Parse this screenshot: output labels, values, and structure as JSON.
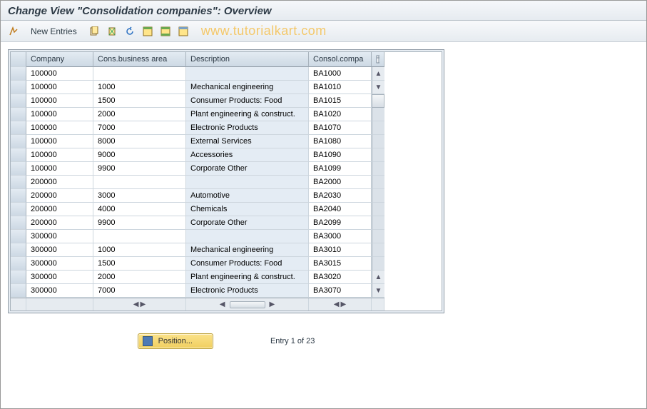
{
  "title": "Change View \"Consolidation companies\": Overview",
  "watermark": "www.tutorialkart.com",
  "toolbar": {
    "new_entries": "New Entries"
  },
  "columns": {
    "company": "Company",
    "cons_ba": "Cons.business area",
    "description": "Description",
    "consol": "Consol.compa"
  },
  "rows": [
    {
      "company": "100000",
      "cba": "",
      "desc": "",
      "cc": "BA1000"
    },
    {
      "company": "100000",
      "cba": "1000",
      "desc": "Mechanical engineering",
      "cc": "BA1010"
    },
    {
      "company": "100000",
      "cba": "1500",
      "desc": "Consumer Products: Food",
      "cc": "BA1015"
    },
    {
      "company": "100000",
      "cba": "2000",
      "desc": "Plant engineering & construct.",
      "cc": "BA1020"
    },
    {
      "company": "100000",
      "cba": "7000",
      "desc": "Electronic Products",
      "cc": "BA1070"
    },
    {
      "company": "100000",
      "cba": "8000",
      "desc": "External Services",
      "cc": "BA1080"
    },
    {
      "company": "100000",
      "cba": "9000",
      "desc": "Accessories",
      "cc": "BA1090"
    },
    {
      "company": "100000",
      "cba": "9900",
      "desc": "Corporate Other",
      "cc": "BA1099"
    },
    {
      "company": "200000",
      "cba": "",
      "desc": "",
      "cc": "BA2000"
    },
    {
      "company": "200000",
      "cba": "3000",
      "desc": "Automotive",
      "cc": "BA2030"
    },
    {
      "company": "200000",
      "cba": "4000",
      "desc": "Chemicals",
      "cc": "BA2040"
    },
    {
      "company": "200000",
      "cba": "9900",
      "desc": "Corporate Other",
      "cc": "BA2099"
    },
    {
      "company": "300000",
      "cba": "",
      "desc": "",
      "cc": "BA3000"
    },
    {
      "company": "300000",
      "cba": "1000",
      "desc": "Mechanical engineering",
      "cc": "BA3010"
    },
    {
      "company": "300000",
      "cba": "1500",
      "desc": "Consumer Products: Food",
      "cc": "BA3015"
    },
    {
      "company": "300000",
      "cba": "2000",
      "desc": "Plant engineering & construct.",
      "cc": "BA3020"
    },
    {
      "company": "300000",
      "cba": "7000",
      "desc": "Electronic Products",
      "cc": "BA3070"
    }
  ],
  "footer": {
    "position_btn": "Position...",
    "entry_text": "Entry 1 of 23"
  }
}
